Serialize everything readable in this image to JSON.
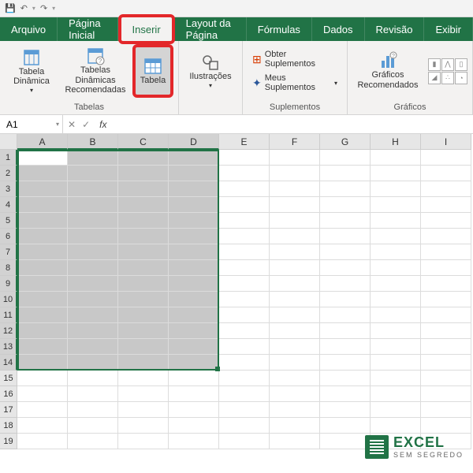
{
  "qat": {
    "save": "💾",
    "undo": "↶",
    "redo": "↷"
  },
  "tabs": {
    "arquivo": "Arquivo",
    "pagina_inicial": "Página Inicial",
    "inserir": "Inserir",
    "layout": "Layout da Página",
    "formulas": "Fórmulas",
    "dados": "Dados",
    "revisao": "Revisão",
    "exibir": "Exibir"
  },
  "ribbon": {
    "tabelas": {
      "label": "Tabelas",
      "tabela_dinamica": "Tabela Dinâmica",
      "tabelas_dinamicas_rec": "Tabelas Dinâmicas Recomendadas",
      "tabela": "Tabela"
    },
    "ilustracoes": {
      "label": "Ilustrações"
    },
    "suplementos": {
      "label": "Suplementos",
      "obter": "Obter Suplementos",
      "meus": "Meus Suplementos"
    },
    "graficos": {
      "label": "Gráficos",
      "recomendados": "Gráficos Recomendados"
    }
  },
  "name_box": "A1",
  "fx": "fx",
  "columns": [
    "A",
    "B",
    "C",
    "D",
    "E",
    "F",
    "G",
    "H",
    "I"
  ],
  "rows": [
    "1",
    "2",
    "3",
    "4",
    "5",
    "6",
    "7",
    "8",
    "9",
    "10",
    "11",
    "12",
    "13",
    "14",
    "15",
    "16",
    "17",
    "18",
    "19"
  ],
  "sel_cols": 4,
  "sel_rows": 14,
  "watermark": {
    "t1": "EXCEL",
    "t2": "SEM SEGREDO"
  }
}
